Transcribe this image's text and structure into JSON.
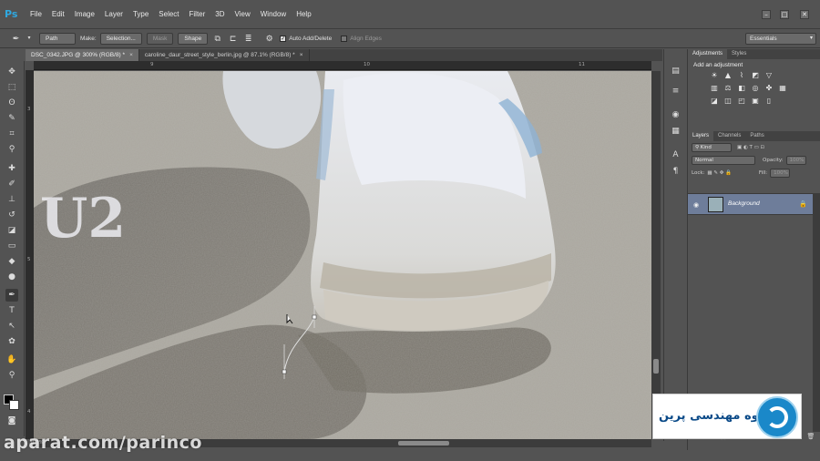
{
  "app": {
    "logo": "Ps",
    "menu": [
      "File",
      "Edit",
      "Image",
      "Layer",
      "Type",
      "Select",
      "Filter",
      "3D",
      "View",
      "Window",
      "Help"
    ],
    "window_controls": [
      "–",
      "□",
      "✕"
    ]
  },
  "options": {
    "mode": "Path",
    "make_label": "Make:",
    "selection_btn": "Selection...",
    "mask_btn": "Mask",
    "shape_btn": "Shape",
    "auto_add_delete": "Auto Add/Delete",
    "align_edges": "Align Edges",
    "workspace": "Essentials"
  },
  "documents": {
    "tabs": [
      {
        "label": "DSC_0342.JPG @ 300% (RGB/8) *"
      },
      {
        "label": "caroline_daur_street_style_berlin.jpg @ 87.1% (RGB/8) *"
      }
    ]
  },
  "rulers": {
    "top": [
      "9",
      "10",
      "11"
    ],
    "left": [
      "3",
      "5",
      "4"
    ]
  },
  "status": {
    "zoom": "300%"
  },
  "panels": {
    "adjustments_tab": "Adjustments",
    "styles_tab": "Styles",
    "add_adjustment": "Add an adjustment",
    "layers_tab": "Layers",
    "channels_tab": "Channels",
    "paths_tab": "Paths",
    "filter_kind": "Kind",
    "blend_mode": "Normal",
    "opacity_label": "Opacity:",
    "opacity_value": "100%",
    "lock_label": "Lock:",
    "fill_label": "Fill:",
    "fill_value": "100%",
    "layer_name": "Background"
  },
  "watermarks": {
    "bottom": "aparat.com/parinco",
    "overlay": "U2",
    "brand": "گروه مهندسی پرین"
  }
}
